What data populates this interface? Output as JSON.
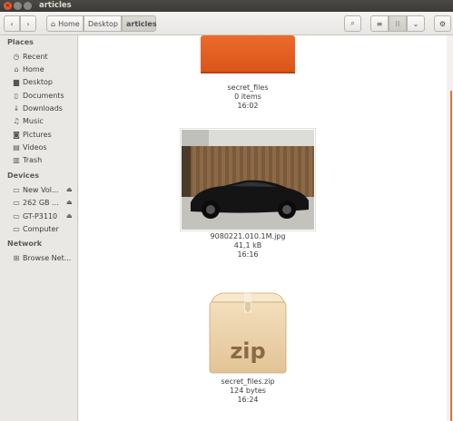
{
  "window": {
    "title": "articles"
  },
  "toolbar": {
    "breadcrumbs": [
      "Home",
      "Desktop",
      "articles"
    ]
  },
  "sidebar": {
    "sections": [
      {
        "title": "Places"
      },
      {
        "title": "Devices"
      },
      {
        "title": "Network"
      }
    ],
    "places": [
      "Recent",
      "Home",
      "Desktop",
      "Documents",
      "Downloads",
      "Music",
      "Pictures",
      "Videos",
      "Trash"
    ],
    "devices": [
      "New Vol...",
      "262 GB ...",
      "GT-P3110",
      "Computer"
    ],
    "network": [
      "Browse Net..."
    ]
  },
  "files": [
    {
      "name": "secret_files",
      "meta1": "0 items",
      "meta2": "16:02"
    },
    {
      "name": "9080221.010.1M.jpg",
      "meta1": "41,1 kB",
      "meta2": "16:16"
    },
    {
      "name": "secret_files.zip",
      "meta1": "124 bytes",
      "meta2": "16:24",
      "badge": "zip"
    }
  ],
  "colors": {
    "accent": "#e8752f",
    "folder": "#e05a1c"
  }
}
